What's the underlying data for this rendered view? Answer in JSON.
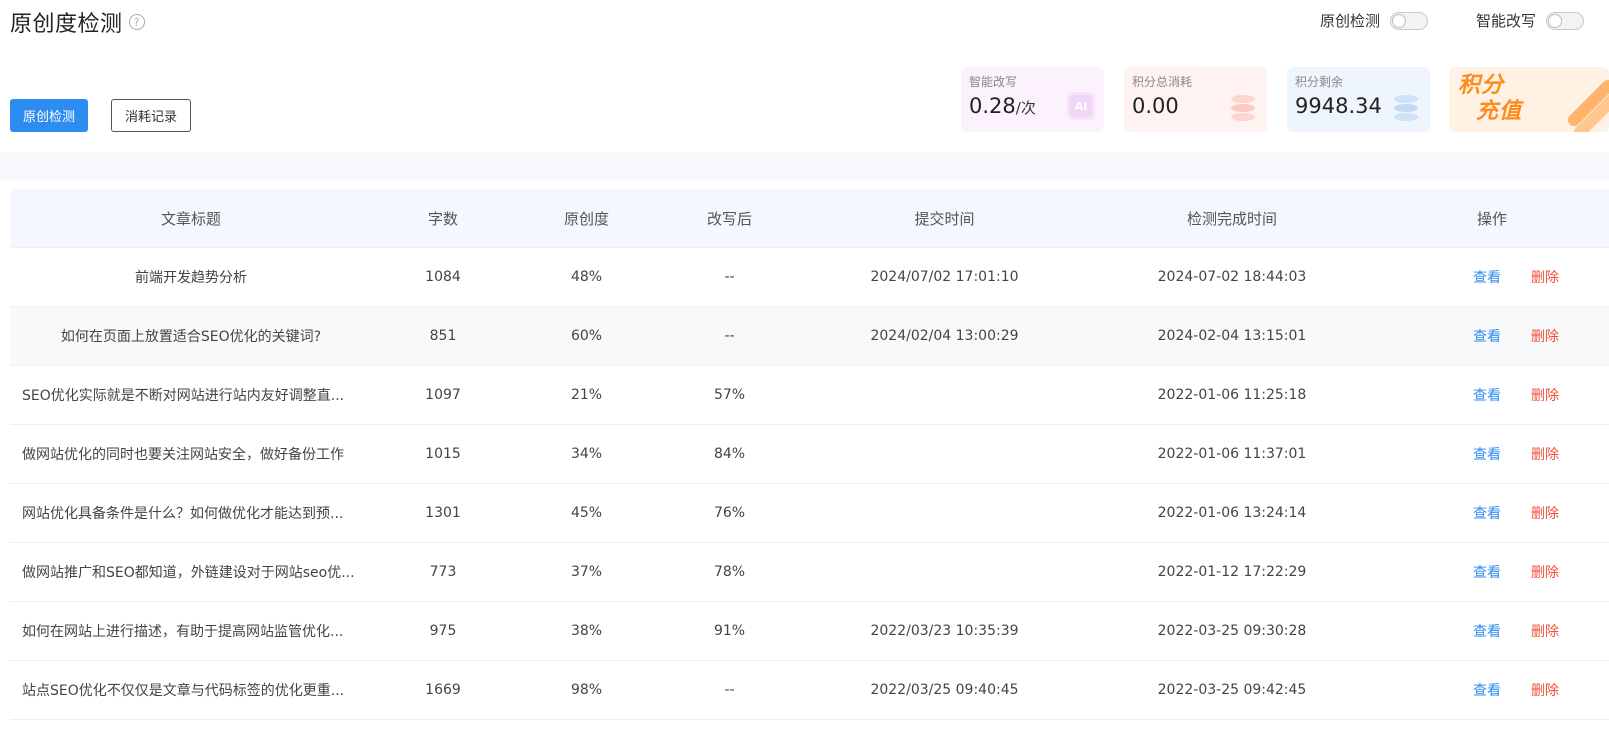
{
  "header": {
    "title": "原创度检测",
    "help_icon": "question-circle-icon",
    "toggles": [
      {
        "label": "原创检测",
        "on": false
      },
      {
        "label": "智能改写",
        "on": false
      }
    ]
  },
  "actions": {
    "detect_label": "原创检测",
    "records_label": "消耗记录"
  },
  "stats": {
    "ai_rewrite": {
      "label": "智能改写",
      "value": "0.28",
      "unit": "/次",
      "icon": "ai-chip-icon",
      "icon_text": "AI"
    },
    "total_cost": {
      "label": "积分总消耗",
      "value": "0.00",
      "icon": "coin-stack-icon"
    },
    "remaining": {
      "label": "积分剩余",
      "value": "9948.34",
      "icon": "coin-stack-icon"
    },
    "recharge": {
      "line1": "积分",
      "line2": "充值"
    }
  },
  "table": {
    "headers": {
      "title": "文章标题",
      "words": "字数",
      "originality": "原创度",
      "rewritten": "改写后",
      "submit_time": "提交时间",
      "done_time": "检测完成时间",
      "ops": "操作"
    },
    "view_label": "查看",
    "delete_label": "删除",
    "rows": [
      {
        "title": "前端开发趋势分析",
        "words": "1084",
        "originality": "48%",
        "rewritten": "--",
        "submit_time": "2024/07/02 17:01:10",
        "done_time": "2024-07-02 18:44:03"
      },
      {
        "title": "如何在页面上放置适合SEO优化的关键词?",
        "words": "851",
        "originality": "60%",
        "rewritten": "--",
        "submit_time": "2024/02/04 13:00:29",
        "done_time": "2024-02-04 13:15:01"
      },
      {
        "title": "SEO优化实际就是不断对网站进行站内友好调整直...",
        "words": "1097",
        "originality": "21%",
        "rewritten": "57%",
        "submit_time": "",
        "done_time": "2022-01-06 11:25:18"
      },
      {
        "title": "做网站优化的同时也要关注网站安全，做好备份工作",
        "words": "1015",
        "originality": "34%",
        "rewritten": "84%",
        "submit_time": "",
        "done_time": "2022-01-06 11:37:01"
      },
      {
        "title": "网站优化具备条件是什么？如何做优化才能达到预...",
        "words": "1301",
        "originality": "45%",
        "rewritten": "76%",
        "submit_time": "",
        "done_time": "2022-01-06 13:24:14"
      },
      {
        "title": "做网站推广和SEO都知道，外链建设对于网站seo优...",
        "words": "773",
        "originality": "37%",
        "rewritten": "78%",
        "submit_time": "",
        "done_time": "2022-01-12 17:22:29"
      },
      {
        "title": "如何在网站上进行描述，有助于提高网站监管优化...",
        "words": "975",
        "originality": "38%",
        "rewritten": "91%",
        "submit_time": "2022/03/23 10:35:39",
        "done_time": "2022-03-25 09:30:28"
      },
      {
        "title": "站点SEO优化不仅仅是文章与代码标签的优化更重...",
        "words": "1669",
        "originality": "98%",
        "rewritten": "--",
        "submit_time": "2022/03/25 09:40:45",
        "done_time": "2022-03-25 09:42:45"
      }
    ]
  },
  "colors": {
    "primary": "#2d8cf0",
    "danger": "#f0503c",
    "recharge": "#ff8a1e"
  }
}
